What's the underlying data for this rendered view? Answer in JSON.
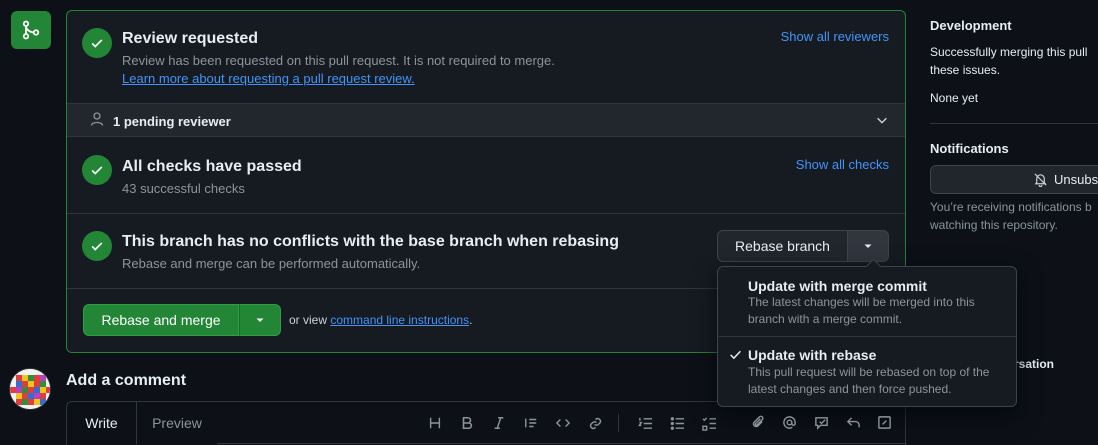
{
  "review": {
    "title": "Review requested",
    "description": "Review has been requested on this pull request. It is not required to merge.",
    "learn_more": "Learn more about requesting a pull request review.",
    "show_all": "Show all reviewers",
    "pending": "1 pending reviewer"
  },
  "checks": {
    "title": "All checks have passed",
    "subtitle": "43 successful checks",
    "show_all": "Show all checks"
  },
  "conflicts": {
    "title": "This branch has no conflicts with the base branch when rebasing",
    "subtitle": "Rebase and merge can be performed automatically.",
    "update_button": "Rebase branch"
  },
  "merge": {
    "button_label": "Rebase and merge",
    "or_view": "or view",
    "cli_link": "command line instructions",
    "period": "."
  },
  "update_menu": {
    "items": [
      {
        "title": "Update with merge commit",
        "desc_line1": "The latest changes will be merged into this",
        "desc_line2": "branch with a merge commit.",
        "selected": false
      },
      {
        "title": "Update with rebase",
        "desc_line1": "This pull request will be rebased on top of the",
        "desc_line2": "latest changes and then force pushed.",
        "selected": true
      }
    ]
  },
  "comment": {
    "heading": "Add a comment",
    "tab_write": "Write",
    "tab_preview": "Preview",
    "toolbar_icons": [
      "heading-icon",
      "bold-icon",
      "italic-icon",
      "quote-icon",
      "code-icon",
      "link-icon",
      "ordered-list-icon",
      "unordered-list-icon",
      "task-list-icon",
      "attach-icon",
      "mention-icon",
      "reference-icon",
      "undo-icon",
      "fullscreen-icon"
    ]
  },
  "sidebar": {
    "development_heading": "Development",
    "development_line1": "Successfully merging this pull",
    "development_line2": "these issues.",
    "development_none": "None yet",
    "notifications_heading": "Notifications",
    "unsubscribe_label": "Unsubsc",
    "notif_line1": "You’re receiving notifications b",
    "notif_line2": "watching this repository.",
    "conversation_partial": "rsation"
  },
  "colors": {
    "success": "#238636",
    "link": "#4493f8",
    "background": "#0d1117",
    "panel": "#161b22"
  }
}
